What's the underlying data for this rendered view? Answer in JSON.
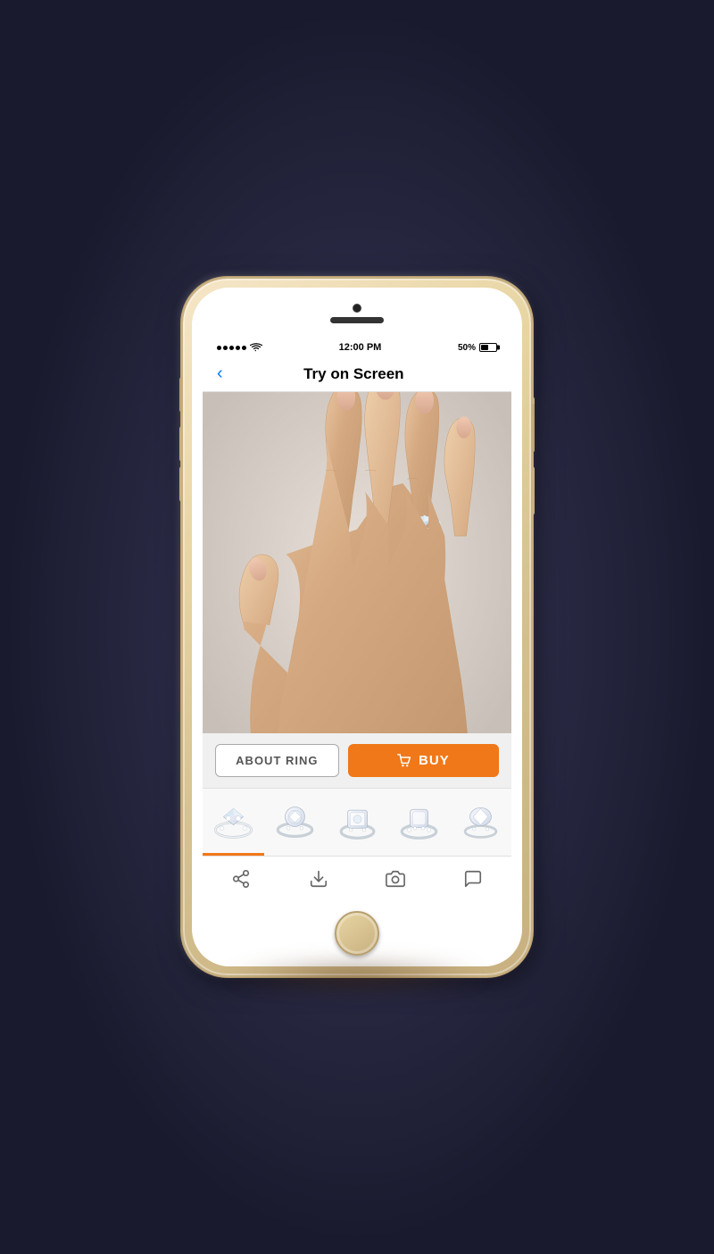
{
  "status_bar": {
    "signal_dots": 5,
    "wifi": "wifi",
    "time": "12:00 PM",
    "battery_pct": "50%",
    "battery_icon": "battery"
  },
  "nav": {
    "back_label": "‹",
    "title": "Try on Screen"
  },
  "actions": {
    "about_ring_label": "ABOUT RING",
    "buy_label": "BUY",
    "buy_icon": "🛍"
  },
  "thumbnails": [
    {
      "id": "ring-1",
      "active": true
    },
    {
      "id": "ring-2",
      "active": false
    },
    {
      "id": "ring-3",
      "active": false
    },
    {
      "id": "ring-4",
      "active": false
    },
    {
      "id": "ring-5",
      "active": false
    }
  ],
  "toolbar": {
    "share_icon": "share",
    "download_icon": "download",
    "camera_icon": "camera",
    "chat_icon": "chat"
  },
  "colors": {
    "accent_orange": "#f07818",
    "nav_blue": "#007aff",
    "active_tab": "#f07818"
  }
}
